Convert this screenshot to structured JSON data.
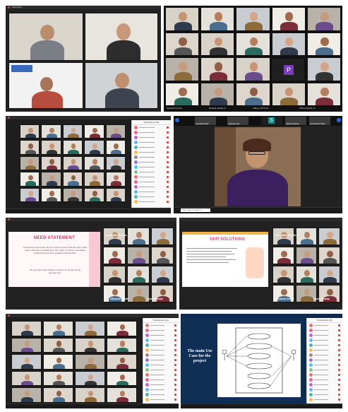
{
  "panels": {
    "p1": {
      "menu": "Recording",
      "tiles": [
        "",
        "",
        "",
        ""
      ]
    },
    "p2": {
      "row_names": [
        "Kaustubh Kuma...",
        "Deepali Janake S...",
        "Aditya_SITTS R...",
        "Ishika Gandhi_S..."
      ],
      "purple_initial": "P"
    },
    "p3": {
      "plist_title": "Participants (40)"
    },
    "p4": {
      "top_names": [
        "Anushka Patil",
        "Vignesh Iyer",
        "Mastya Dubey",
        "Harshwani Saur..."
      ],
      "s_initial": "S",
      "taskbar_search": "Type here to search"
    },
    "p5": {
      "title": "NEED STATEMENT",
      "body": "Through the app people can join support groups that are a few clicks away, while also providing them the option to choose counselling medical services from qualified professionals.",
      "body2": "The app also holds helpline numbers for people during emergencies.",
      "names": [
        "Anvanth G Kris...",
        "Atharva Joshi",
        "Syna Dhoka"
      ]
    },
    "p6": {
      "title": "OUR SOLUTIONS",
      "names": [
        "Anvanth G Kris...",
        "Atharva Joshi",
        "Syna Dhoka"
      ]
    },
    "p7": {
      "plist_title": "Participants (41)"
    },
    "p8": {
      "slide_text": "The main Use Case for the project",
      "plist_title": "Participants (40)"
    }
  }
}
